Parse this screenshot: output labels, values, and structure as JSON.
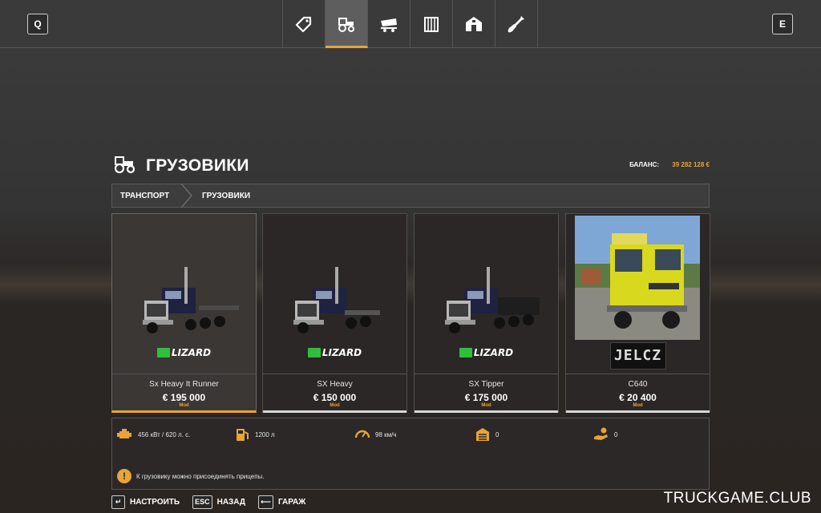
{
  "topbar": {
    "left_key": "Q",
    "right_key": "E",
    "tabs": [
      {
        "icon": "price-tag-icon",
        "active": false
      },
      {
        "icon": "tractor-icon",
        "active": true
      },
      {
        "icon": "tipper-icon",
        "active": false
      },
      {
        "icon": "equipment-icon",
        "active": false
      },
      {
        "icon": "barn-icon",
        "active": false
      },
      {
        "icon": "shovel-icon",
        "active": false
      }
    ]
  },
  "header": {
    "title": "ГРУЗОВИКИ",
    "balance_label": "БАЛАНС:",
    "balance_value": "39 282 128 €"
  },
  "breadcrumb": [
    "ТРАНСПОРТ",
    "ГРУЗОВИКИ"
  ],
  "cards": [
    {
      "name": "Sx Heavy It Runner",
      "price": "€ 195 000",
      "tag": "Mod",
      "brand": "LIZARD",
      "selected": true
    },
    {
      "name": "SX Heavy",
      "price": "€ 150 000",
      "tag": "Mod",
      "brand": "LIZARD",
      "selected": false
    },
    {
      "name": "SX Tipper",
      "price": "€ 175 000",
      "tag": "Mod",
      "brand": "LIZARD",
      "selected": false
    },
    {
      "name": "C640",
      "price": "€ 20 400",
      "tag": "Mod",
      "brand": "JELCZ",
      "selected": false
    }
  ],
  "stats": {
    "power": "456 кВт / 620 л. с.",
    "fuel": "1200 л",
    "speed": "98 км/ч",
    "upkeep": "0",
    "income": "0",
    "note": "К грузовику можно присоединять прицепы."
  },
  "actions": [
    {
      "key": "↵",
      "label": "НАСТРОИТЬ"
    },
    {
      "key": "ESC",
      "label": "НАЗАД"
    },
    {
      "key": "⟵",
      "label": "ГАРАЖ"
    }
  ],
  "watermark": "TRUCKGAME.CLUB",
  "colors": {
    "accent": "#e8a33a",
    "lizard_green": "#2fbf3c",
    "jelcz_yellow": "#d8d81e"
  }
}
